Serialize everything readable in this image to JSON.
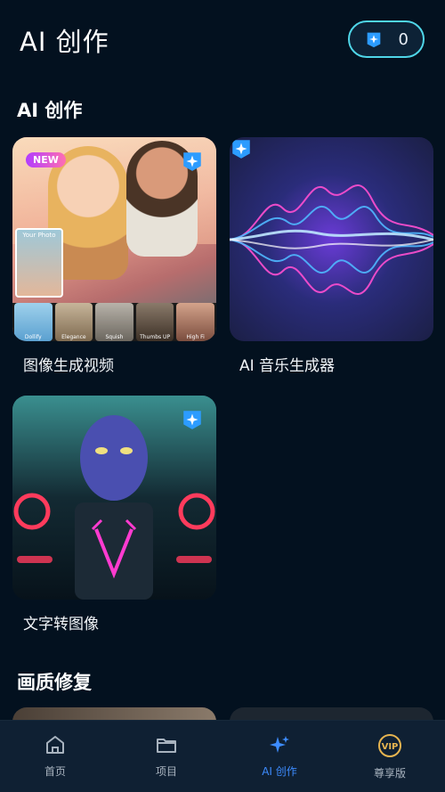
{
  "header": {
    "title": "AI 创作",
    "credits_count": "0"
  },
  "sections": [
    {
      "title": "AI 创作",
      "cards": [
        {
          "label": "图像生成视频",
          "badge": "NEW",
          "inset_label": "Your Photo",
          "thumbs": [
            "Dollify",
            "Elegance",
            "Squish",
            "Thumbs UP",
            "High Fi"
          ]
        },
        {
          "label": "AI 音乐生成器"
        },
        {
          "label": "文字转图像"
        }
      ]
    },
    {
      "title": "画质修复"
    }
  ],
  "nav": {
    "items": [
      {
        "label": "首页",
        "icon": "home-icon"
      },
      {
        "label": "项目",
        "icon": "folder-icon"
      },
      {
        "label": "AI 创作",
        "icon": "sparkle-icon",
        "active": true
      },
      {
        "label": "尊享版",
        "icon": "vip-icon"
      }
    ]
  },
  "colors": {
    "background": "#03111f",
    "accent": "#3d8cff",
    "credits_border": "#4fd6e8"
  }
}
